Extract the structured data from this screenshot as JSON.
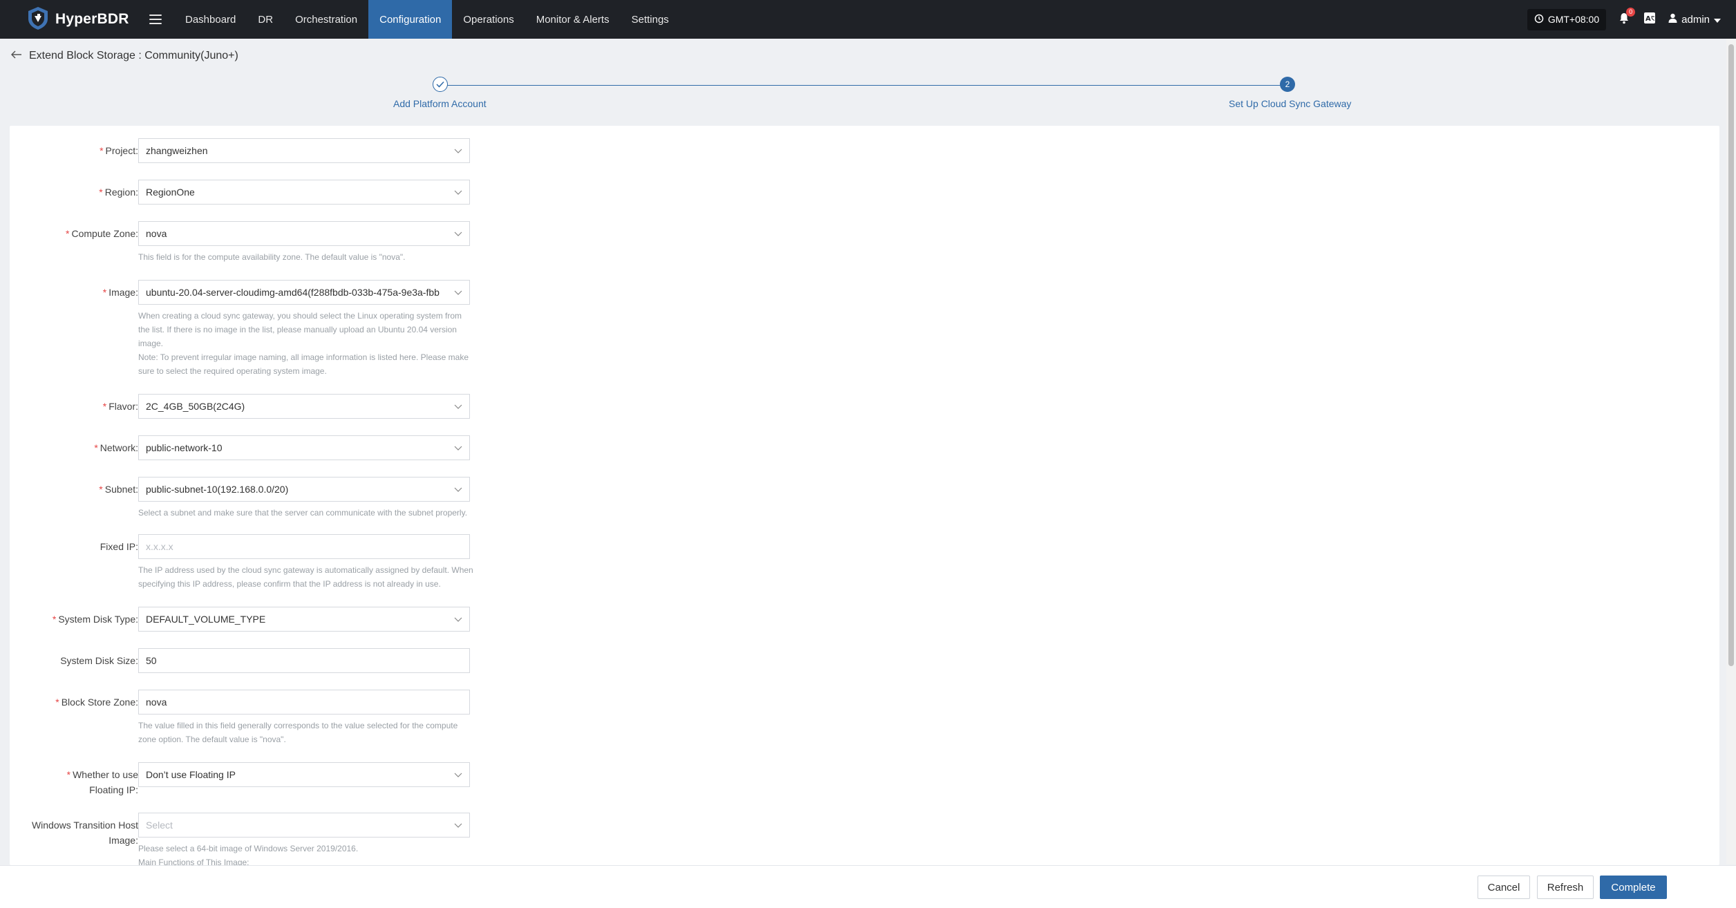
{
  "app": {
    "brand": "HyperBDR"
  },
  "nav": {
    "items": [
      {
        "label": "Dashboard",
        "active": false
      },
      {
        "label": "DR",
        "active": false
      },
      {
        "label": "Orchestration",
        "active": false
      },
      {
        "label": "Configuration",
        "active": true
      },
      {
        "label": "Operations",
        "active": false
      },
      {
        "label": "Monitor & Alerts",
        "active": false
      },
      {
        "label": "Settings",
        "active": false
      }
    ],
    "timezone": "GMT+08:00",
    "notification_count": "0",
    "user": "admin"
  },
  "page": {
    "title": "Extend Block Storage : Community(Juno+)"
  },
  "steps": [
    {
      "label": "Add Platform Account",
      "status": "done"
    },
    {
      "number": "2",
      "label": "Set Up Cloud Sync Gateway",
      "status": "current"
    }
  ],
  "form": {
    "project": {
      "label": "Project:",
      "value": "zhangweizhen"
    },
    "region": {
      "label": "Region:",
      "value": "RegionOne"
    },
    "compute_zone": {
      "label": "Compute Zone:",
      "value": "nova",
      "help": "This field is for the compute availability zone. The default value is \"nova\"."
    },
    "image": {
      "label": "Image:",
      "value": "ubuntu-20.04-server-cloudimg-amd64(f288fbdb-033b-475a-9e3a-fbb",
      "help": "When creating a cloud sync gateway, you should select the Linux operating system from the list. If there is no image in the list, please manually upload an Ubuntu 20.04 version image.",
      "note": "Note: To prevent irregular image naming, all image information is listed here. Please make sure to select the required operating system image."
    },
    "flavor": {
      "label": "Flavor:",
      "value": "2C_4GB_50GB(2C4G)"
    },
    "network": {
      "label": "Network:",
      "value": "public-network-10"
    },
    "subnet": {
      "label": "Subnet:",
      "value": "public-subnet-10(192.168.0.0/20)",
      "help": "Select a subnet and make sure that the server can communicate with the subnet properly."
    },
    "fixed_ip": {
      "label": "Fixed IP:",
      "placeholder": "x.x.x.x",
      "help": "The IP address used by the cloud sync gateway is automatically assigned by default. When specifying this IP address, please confirm that the IP address is not already in use."
    },
    "system_disk_type": {
      "label": "System Disk Type:",
      "value": "DEFAULT_VOLUME_TYPE"
    },
    "system_disk_size": {
      "label": "System Disk Size:",
      "value": "50"
    },
    "block_store_zone": {
      "label": "Block Store Zone:",
      "value": "nova",
      "help": "The value filled in this field generally corresponds to the value selected for the compute zone option. The default value is \"nova\"."
    },
    "floating_ip": {
      "label_line1": "Whether to use",
      "label_line2": "Floating IP:",
      "value": "Don’t use Floating IP"
    },
    "windows_host_image": {
      "label_line1": "Windows Transition Host",
      "label_line2": "Image:",
      "placeholder": "Select",
      "help": "Please select a 64-bit image of Windows Server 2019/2016.",
      "help2": "Main Functions of This Image:"
    }
  },
  "footer": {
    "cancel": "Cancel",
    "refresh": "Refresh",
    "complete": "Complete"
  },
  "colors": {
    "nav_bg": "#1f2227",
    "accent": "#2f6aa8",
    "required": "#e64545"
  }
}
